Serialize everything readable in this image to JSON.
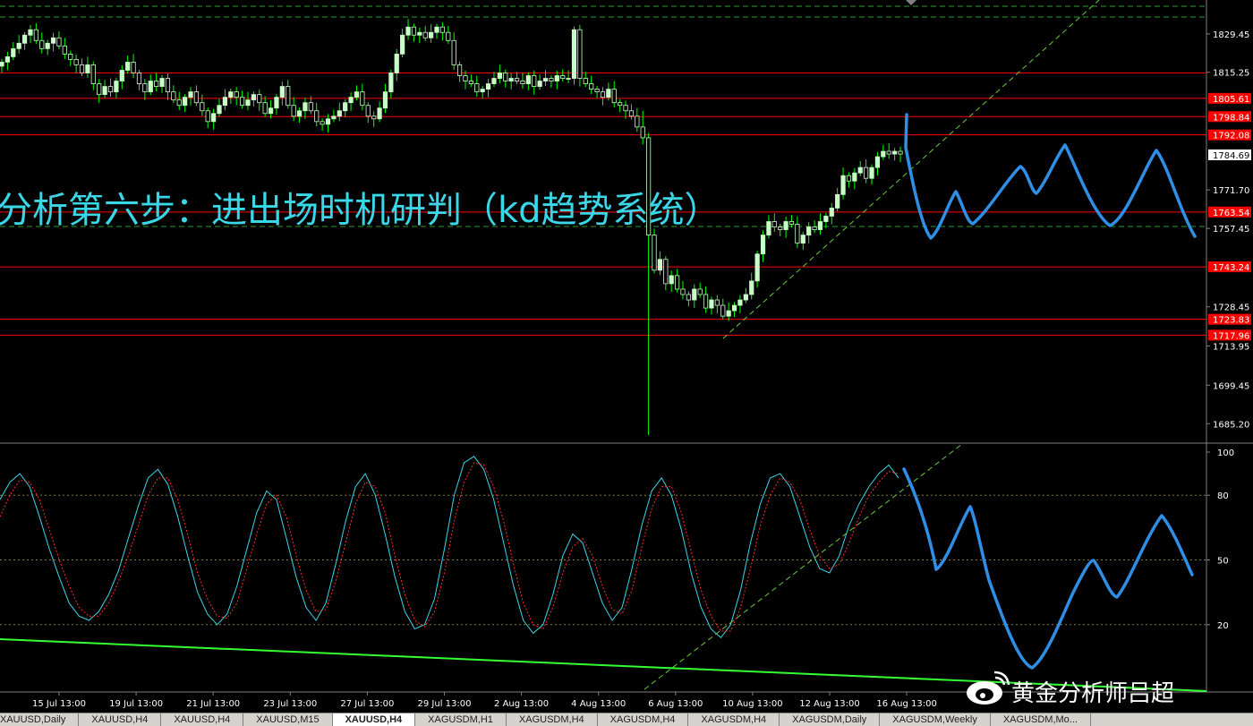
{
  "colors": {
    "background": "#000000",
    "bull_candle": "#c8ffc8",
    "bear_candle": "#c8ffc8",
    "wick": "#00ff00",
    "resistance_line": "#ff0000",
    "price_label_bg": "#ff0000",
    "forecast_path": "#2f8fe6",
    "k_line": "#3ad7e8",
    "d_line": "#ff2b2b",
    "trend_dashed": "#66cc33",
    "bottom_trend": "#33ff33",
    "annotation_text": "#3ad7e8"
  },
  "annotation": "分析第六步：进出场时机研判（kd趋势系统）",
  "watermark": "黄金分析师吕超",
  "watermark_icon": "weibo-icon",
  "tabs": [
    {
      "label": "XAUUSD,Daily",
      "active": false
    },
    {
      "label": "XAUUSD,H4",
      "active": false
    },
    {
      "label": "XAUUSD,H4",
      "active": false
    },
    {
      "label": "XAUUSD,M15",
      "active": false
    },
    {
      "label": "XAUUSD,H4",
      "active": true
    },
    {
      "label": "XAGUSDM,H1",
      "active": false
    },
    {
      "label": "XAGUSDM,H4",
      "active": false
    },
    {
      "label": "XAGUSDM,H4",
      "active": false
    },
    {
      "label": "XAGUSDM,H4",
      "active": false
    },
    {
      "label": "XAGUSDM,Daily",
      "active": false
    },
    {
      "label": "XAGUSDM,Weekly",
      "active": false
    },
    {
      "label": "XAGUSDM,Mo...",
      "active": false
    }
  ],
  "chart_data": [
    {
      "type": "candlestick",
      "symbol": "XAUUSD",
      "timeframe": "H4",
      "ylim": [
        1678.0,
        1842.0
      ],
      "y_ticks": [
        1829.45,
        1815.25,
        1771.7,
        1757.45,
        1728.45,
        1713.95,
        1699.45,
        1685.2
      ],
      "current_price": 1784.69,
      "current_price_label": "1784.69",
      "horizontal_levels": [
        {
          "value": 1815.0,
          "label": ""
        },
        {
          "value": 1805.61,
          "label": "1805.61"
        },
        {
          "value": 1798.84,
          "label": "1798.84"
        },
        {
          "value": 1792.08,
          "label": "1792.08"
        },
        {
          "value": 1763.54,
          "label": "1763.54"
        },
        {
          "value": 1743.24,
          "label": "1743.24"
        },
        {
          "value": 1723.83,
          "label": "1723.83"
        },
        {
          "value": 1717.96,
          "label": "1717.96"
        }
      ],
      "x_labels": [
        "15 Jul 13:00",
        "19 Jul 13:00",
        "21 Jul 13:00",
        "23 Jul 13:00",
        "27 Jul 13:00",
        "29 Jul 13:00",
        "2 Aug 13:00",
        "4 Aug 13:00",
        "6 Aug 13:00",
        "10 Aug 13:00",
        "12 Aug 13:00",
        "16 Aug 13:00"
      ],
      "closes": [
        1819,
        1821,
        1824,
        1826,
        1829,
        1831,
        1827,
        1824,
        1826,
        1828,
        1825,
        1822,
        1820,
        1818,
        1815,
        1818,
        1811,
        1807,
        1810,
        1808,
        1812,
        1816,
        1819,
        1815,
        1811,
        1808,
        1812,
        1810,
        1813,
        1808,
        1805,
        1803,
        1806,
        1808,
        1804,
        1801,
        1797,
        1800,
        1803,
        1806,
        1808,
        1806,
        1803,
        1805,
        1807,
        1804,
        1800,
        1802,
        1806,
        1810,
        1803,
        1799,
        1801,
        1804,
        1801,
        1797,
        1796,
        1798,
        1799,
        1801,
        1804,
        1806,
        1808,
        1803,
        1799,
        1798,
        1802,
        1808,
        1815,
        1822,
        1829,
        1832,
        1829,
        1830,
        1828,
        1830,
        1832,
        1830,
        1827,
        1818,
        1814,
        1812,
        1811,
        1808,
        1809,
        1811,
        1813,
        1815,
        1812,
        1813,
        1812,
        1811,
        1814,
        1810,
        1812,
        1813,
        1812,
        1814,
        1813,
        1813,
        1831,
        1813,
        1811,
        1809,
        1808,
        1806,
        1809,
        1804,
        1803,
        1801,
        1799,
        1795,
        1791,
        1755,
        1742,
        1746,
        1737,
        1740,
        1735,
        1733,
        1731,
        1735,
        1733,
        1728,
        1731,
        1729,
        1725,
        1727,
        1729,
        1731,
        1733,
        1738,
        1748,
        1755,
        1760,
        1758,
        1757,
        1760,
        1759,
        1752,
        1755,
        1758,
        1757,
        1760,
        1762,
        1765,
        1770,
        1777,
        1775,
        1778,
        1780,
        1776,
        1780,
        1784,
        1786,
        1785,
        1786,
        1785
      ]
    },
    {
      "type": "line",
      "indicator": "KD",
      "ylim": [
        0,
        100
      ],
      "y_ticks": [
        100,
        80,
        50,
        20
      ],
      "level_lines": [
        80,
        50,
        20
      ],
      "series": [
        {
          "values": [
            78,
            86,
            90,
            84,
            70,
            55,
            42,
            30,
            24,
            22,
            26,
            34,
            45,
            60,
            75,
            88,
            92,
            85,
            70,
            52,
            35,
            25,
            20,
            25,
            38,
            55,
            72,
            82,
            78,
            60,
            42,
            28,
            22,
            30,
            48,
            68,
            84,
            90,
            80,
            62,
            42,
            26,
            18,
            20,
            32,
            55,
            80,
            95,
            98,
            92,
            78,
            58,
            38,
            22,
            16,
            20,
            34,
            52,
            62,
            58,
            44,
            30,
            22,
            28,
            46,
            66,
            82,
            88,
            80,
            64,
            44,
            28,
            18,
            14,
            20,
            36,
            58,
            76,
            88,
            90,
            84,
            70,
            56,
            46,
            44,
            52,
            66,
            76,
            84,
            90,
            94,
            88
          ]
        },
        {
          "values": [
            70,
            80,
            87,
            86,
            78,
            64,
            50,
            38,
            28,
            24,
            24,
            30,
            40,
            52,
            66,
            80,
            88,
            88,
            78,
            62,
            44,
            32,
            24,
            23,
            30,
            46,
            62,
            76,
            80,
            70,
            52,
            36,
            26,
            27,
            40,
            58,
            76,
            86,
            84,
            72,
            52,
            34,
            22,
            19,
            26,
            44,
            68,
            86,
            95,
            94,
            84,
            68,
            48,
            30,
            20,
            18,
            28,
            44,
            56,
            60,
            52,
            38,
            27,
            25,
            36,
            56,
            74,
            84,
            84,
            72,
            54,
            36,
            24,
            17,
            17,
            28,
            46,
            66,
            80,
            88,
            86,
            78,
            64,
            52,
            46,
            48,
            58,
            70,
            80,
            86,
            91,
            90
          ]
        }
      ]
    }
  ]
}
